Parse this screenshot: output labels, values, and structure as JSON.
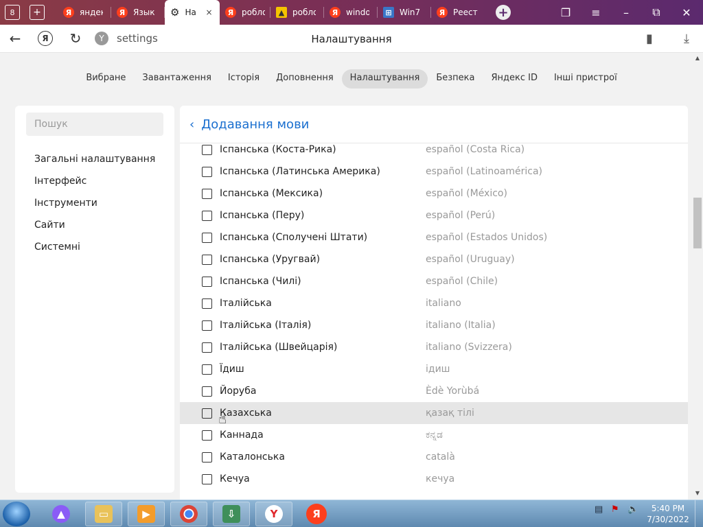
{
  "tabbar": {
    "tab_count_badge": "8",
    "tabs": [
      {
        "label": "яндек",
        "type": "yandex"
      },
      {
        "label": "Язык",
        "type": "yandex"
      },
      {
        "label": "На",
        "type": "settings",
        "active": true
      },
      {
        "label": "робло",
        "type": "yandex"
      },
      {
        "label": "робло",
        "type": "image"
      },
      {
        "label": "windo",
        "type": "yandex"
      },
      {
        "label": "Win7",
        "type": "win"
      },
      {
        "label": "Реестр",
        "type": "yandex"
      }
    ],
    "close_icon": "×",
    "new_tab_icon": "+"
  },
  "address": {
    "url": "settings",
    "page_title": "Налаштування"
  },
  "topnav": {
    "items": [
      "Вибране",
      "Завантаження",
      "Історія",
      "Доповнення",
      "Налаштування",
      "Безпека",
      "Яндекс ID",
      "Інші пристрої"
    ],
    "active_index": 4
  },
  "sidebar": {
    "search_placeholder": "Пошук",
    "items": [
      "Загальні налаштування",
      "Інтерфейс",
      "Інструменти",
      "Сайти",
      "Системні"
    ]
  },
  "main": {
    "title": "Додавання мови",
    "languages": [
      {
        "name": "Іспанська (Коста-Рика)",
        "native": "español (Costa Rica)"
      },
      {
        "name": "Іспанська (Латинська Америка)",
        "native": "español (Latinoamérica)"
      },
      {
        "name": "Іспанська (Мексика)",
        "native": "español (México)"
      },
      {
        "name": "Іспанська (Перу)",
        "native": "español (Perú)"
      },
      {
        "name": "Іспанська (Сполучені Штати)",
        "native": "español (Estados Unidos)"
      },
      {
        "name": "Іспанська (Уругвай)",
        "native": "español (Uruguay)"
      },
      {
        "name": "Іспанська (Чилі)",
        "native": "español (Chile)"
      },
      {
        "name": "Італійська",
        "native": "italiano"
      },
      {
        "name": "Італійська (Італія)",
        "native": "italiano (Italia)"
      },
      {
        "name": "Італійська (Швейцарія)",
        "native": "italiano (Svizzera)"
      },
      {
        "name": "Їдиш",
        "native": "ідиш"
      },
      {
        "name": "Йоруба",
        "native": "Èdè Yorùbá"
      },
      {
        "name": "Казахська",
        "native": "қазақ тілі",
        "hovered": true
      },
      {
        "name": "Каннада",
        "native": "ಕನ್ನಡ"
      },
      {
        "name": "Каталонська",
        "native": "català"
      },
      {
        "name": "Кечуа",
        "native": "кечуа"
      }
    ]
  },
  "taskbar": {
    "time": "5:40 PM",
    "date": "7/30/2022"
  },
  "colors": {
    "accent": "#1a6fcf",
    "yandex_red": "#fc3f1d"
  }
}
